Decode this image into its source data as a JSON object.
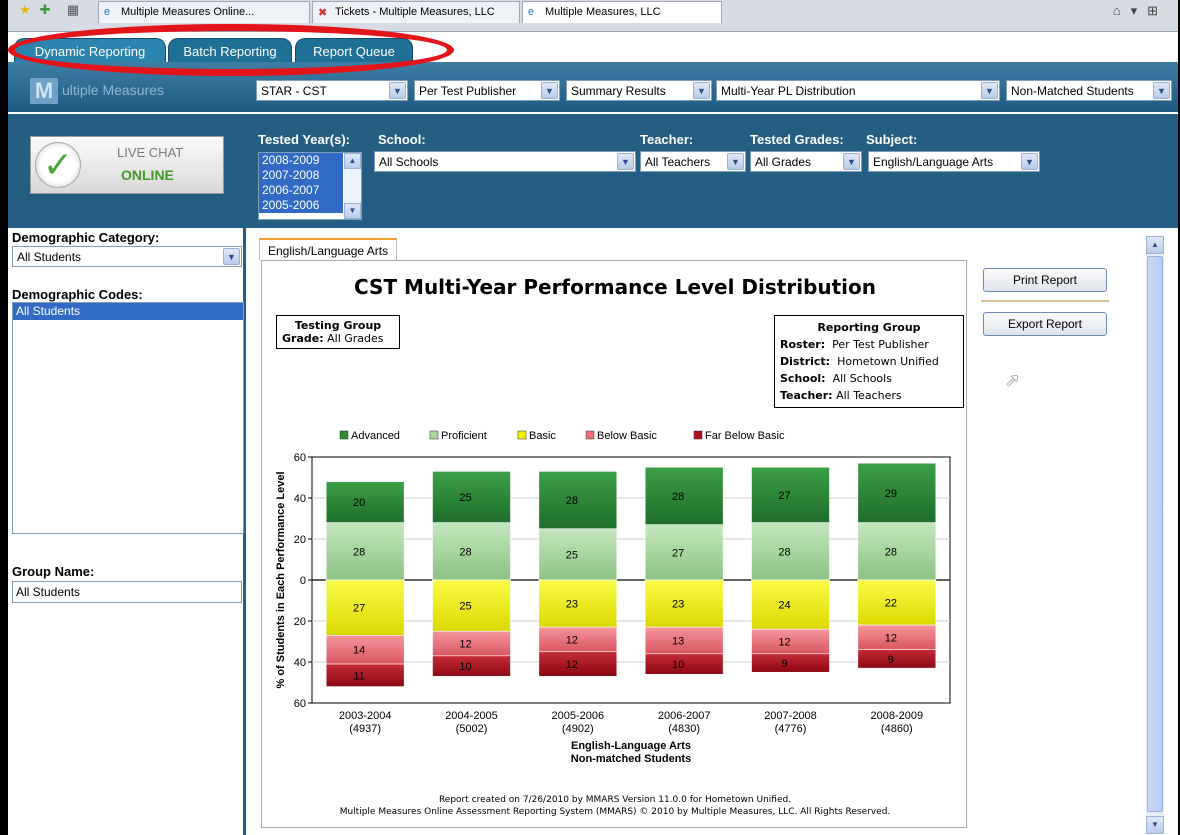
{
  "browser": {
    "tabs": [
      {
        "label": "Multiple Measures Online...",
        "icon": "ie-page-icon"
      },
      {
        "label": "Tickets - Multiple Measures, LLC",
        "icon": "tickets-icon"
      },
      {
        "label": "Multiple Measures, LLC",
        "icon": "ie-page-icon"
      }
    ]
  },
  "app_tabs": [
    "Dynamic Reporting",
    "Batch Reporting",
    "Report Queue"
  ],
  "logo_text": "ultiple Measures",
  "toolbar": {
    "test": "STAR - CST",
    "publisher": "Per Test Publisher",
    "results": "Summary Results",
    "report_type": "Multi-Year PL Distribution",
    "students": "Non-Matched Students"
  },
  "live_chat": {
    "line1": "LIVE CHAT",
    "line2": "ONLINE"
  },
  "filters": {
    "tested_years_label": "Tested Year(s):",
    "tested_years": [
      "2008-2009",
      "2007-2008",
      "2006-2007",
      "2005-2006"
    ],
    "school_label": "School:",
    "school": "All Schools",
    "teacher_label": "Teacher:",
    "teacher": "All Teachers",
    "grades_label": "Tested Grades:",
    "grades": "All Grades",
    "subject_label": "Subject:",
    "subject": "English/Language Arts"
  },
  "left": {
    "demo_category_label": "Demographic Category:",
    "demo_category": "All Students",
    "demo_codes_label": "Demographic Codes:",
    "demo_codes": [
      "All Students"
    ],
    "group_name_label": "Group Name:",
    "group_name": "All Students"
  },
  "report": {
    "tab": "English/Language Arts",
    "title": "CST Multi-Year Performance Level Distribution",
    "testing_group": {
      "heading": "Testing Group",
      "grade_label": "Grade:",
      "grade": "All Grades"
    },
    "reporting_group": {
      "heading": "Reporting Group",
      "roster_label": "Roster:",
      "roster": "Per Test Publisher",
      "district_label": "District:",
      "district": "Hometown Unified",
      "school_label": "School:",
      "school": "All Schools",
      "teacher_label": "Teacher:",
      "teacher": "All Teachers"
    },
    "footer1": "Report created on 7/26/2010 by MMARS Version 11.0.0 for Hometown Unified.",
    "footer2": "Multiple Measures Online Assessment Reporting System (MMARS) © 2010 by Multiple Measures, LLC. All Rights Reserved."
  },
  "buttons": {
    "print": "Print Report",
    "export": "Export Report"
  },
  "chart_data": {
    "type": "bar",
    "stacked": "diverging",
    "ylabel": "% of Students in Each Performance Level",
    "xlabel": "English-Language Arts",
    "xlabel2": "Non-matched Students",
    "ylim": [
      -60,
      60
    ],
    "yticks": [
      "60",
      "40",
      "20",
      "0",
      "20",
      "40",
      "60"
    ],
    "categories": [
      "2003-2004",
      "2004-2005",
      "2005-2006",
      "2006-2007",
      "2007-2008",
      "2008-2009"
    ],
    "counts": [
      "(4937)",
      "(5002)",
      "(4902)",
      "(4830)",
      "(4776)",
      "(4860)"
    ],
    "legend_position": "top",
    "series": [
      {
        "name": "Advanced",
        "color": "#2e8b3a",
        "direction": "up",
        "values": [
          20,
          25,
          28,
          28,
          27,
          29
        ]
      },
      {
        "name": "Proficient",
        "color": "#a8d8a0",
        "direction": "up",
        "values": [
          28,
          28,
          25,
          27,
          28,
          28
        ]
      },
      {
        "name": "Basic",
        "color": "#f2f200",
        "direction": "down",
        "values": [
          27,
          25,
          23,
          23,
          24,
          22
        ]
      },
      {
        "name": "Below Basic",
        "color": "#ef6f78",
        "direction": "down",
        "values": [
          14,
          12,
          12,
          13,
          12,
          12
        ]
      },
      {
        "name": "Far Below Basic",
        "color": "#b01020",
        "direction": "down",
        "values": [
          11,
          10,
          12,
          10,
          9,
          9
        ]
      }
    ]
  }
}
